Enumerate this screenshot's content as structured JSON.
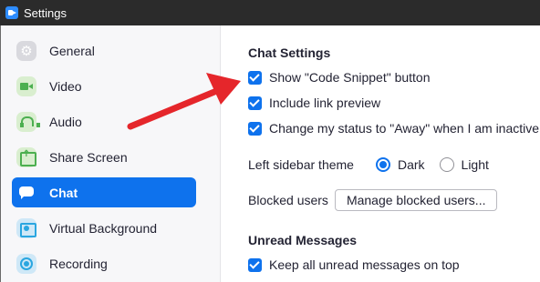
{
  "window": {
    "title": "Settings"
  },
  "sidebar": {
    "items": [
      {
        "label": "General",
        "icon": "gear-icon"
      },
      {
        "label": "Video",
        "icon": "video-camera-icon"
      },
      {
        "label": "Audio",
        "icon": "headphones-icon"
      },
      {
        "label": "Share Screen",
        "icon": "share-screen-icon"
      },
      {
        "label": "Chat",
        "icon": "chat-bubble-icon",
        "active": true
      },
      {
        "label": "Virtual Background",
        "icon": "virtual-background-icon"
      },
      {
        "label": "Recording",
        "icon": "recording-icon"
      }
    ]
  },
  "main": {
    "chat_settings_title": "Chat Settings",
    "show_code_snippet_label": "Show \"Code Snippet\" button",
    "show_code_snippet_checked": true,
    "include_link_preview_label": "Include link preview",
    "include_link_preview_checked": true,
    "away_status_label": "Change my status to \"Away\" when I am inactive for",
    "away_status_checked": true,
    "left_sidebar_theme_label": "Left sidebar theme",
    "theme_dark_label": "Dark",
    "theme_light_label": "Light",
    "theme_selected": "Dark",
    "blocked_users_label": "Blocked users",
    "manage_blocked_users_button": "Manage blocked users...",
    "unread_messages_title": "Unread Messages",
    "keep_unread_label": "Keep all unread messages on top",
    "keep_unread_checked": true
  },
  "colors": {
    "accent": "#0e72ed",
    "titlebar": "#2b2b2b",
    "annotation_arrow": "#e5262b"
  }
}
